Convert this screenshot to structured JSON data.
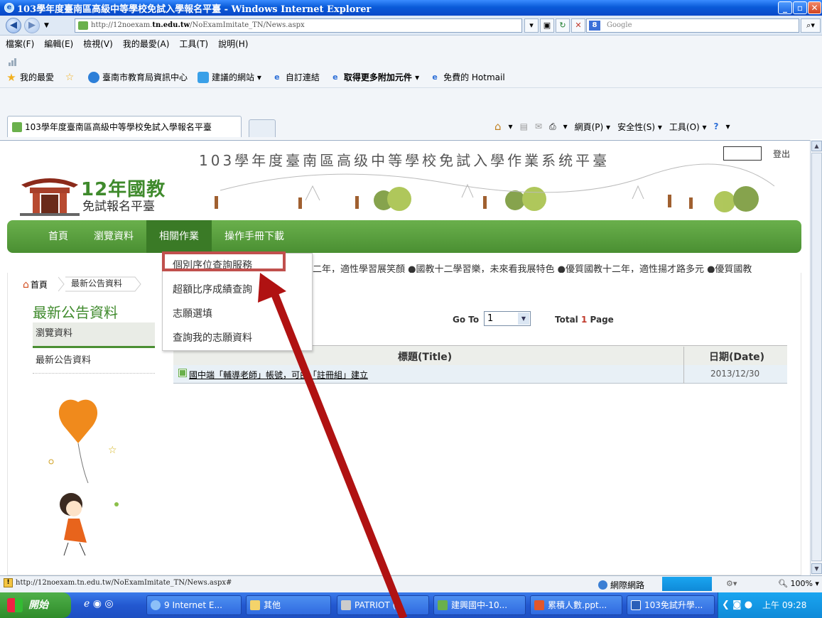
{
  "window": {
    "title": "103學年度臺南區高級中等學校免試入學報名平臺 - Windows Internet Explorer"
  },
  "address": {
    "url_prefix": "http://12noexam.",
    "url_host": "tn.edu.tw",
    "url_path": "/NoExamImitate_TN/News.aspx",
    "search_placeholder": "Google"
  },
  "menubar": {
    "items": [
      "檔案(F)",
      "編輯(E)",
      "檢視(V)",
      "我的最愛(A)",
      "工具(T)",
      "說明(H)"
    ]
  },
  "favorites": {
    "label": "我的最愛",
    "items": [
      "臺南市教育局資訊中心",
      "建議的網站 ▾",
      "自訂連結",
      "取得更多附加元件 ▾",
      "免費的 Hotmail"
    ]
  },
  "tab": {
    "title": "103學年度臺南區高級中等學校免試入學報名平臺"
  },
  "commandbar": {
    "items": [
      "▾",
      "▾",
      "網頁(P) ▾",
      "安全性(S) ▾",
      "工具(O) ▾",
      "▾"
    ]
  },
  "site": {
    "title": "103學年度臺南區高级中等學校免試入學作業系统平臺",
    "logout": "登出",
    "logo_main": "12年國教",
    "logo_sub": "免試報名平臺"
  },
  "nav": {
    "items": [
      "首頁",
      "瀏覽資料",
      "相關作業",
      "操作手冊下載"
    ]
  },
  "dropdown": {
    "items": [
      "個別序位查詢服務",
      "超額比序成績查詢",
      "志願選填",
      "查詢我的志願資料"
    ]
  },
  "marquee": "二年，適性學習展笑顏 ●國教十二學習樂，未來看我展特色 ●優質國教十二年，適性揚才路多元 ●優質國教",
  "breadcrumb": {
    "home": "首頁",
    "current": "最新公告資料"
  },
  "sidebar": {
    "title": "最新公告資料",
    "items": [
      "瀏覽資料",
      "最新公告資料"
    ]
  },
  "pager": {
    "goto_label": "Go To",
    "page_value": "1",
    "total_prefix": "Total ",
    "total_pages": "1",
    "total_suffix": " Page"
  },
  "table": {
    "headers": [
      "標題(Title)",
      "日期(Date)"
    ],
    "rows": [
      {
        "title": "國中端「輔導老師」帳號，可由「註冊組」建立",
        "date": "2013/12/30"
      }
    ]
  },
  "statusbar": {
    "url": "http://12noexam.tn.edu.tw/NoExamImitate_TN/News.aspx#",
    "zone": "網際網路",
    "zoom": "100%"
  },
  "taskbar": {
    "start": "開始",
    "tasks": [
      "9 Internet E...",
      "其他",
      "PATRIOT (",
      "建興國中-10...",
      "累積人數.ppt...",
      "103免試升學..."
    ],
    "clock": "上午 09:28"
  }
}
